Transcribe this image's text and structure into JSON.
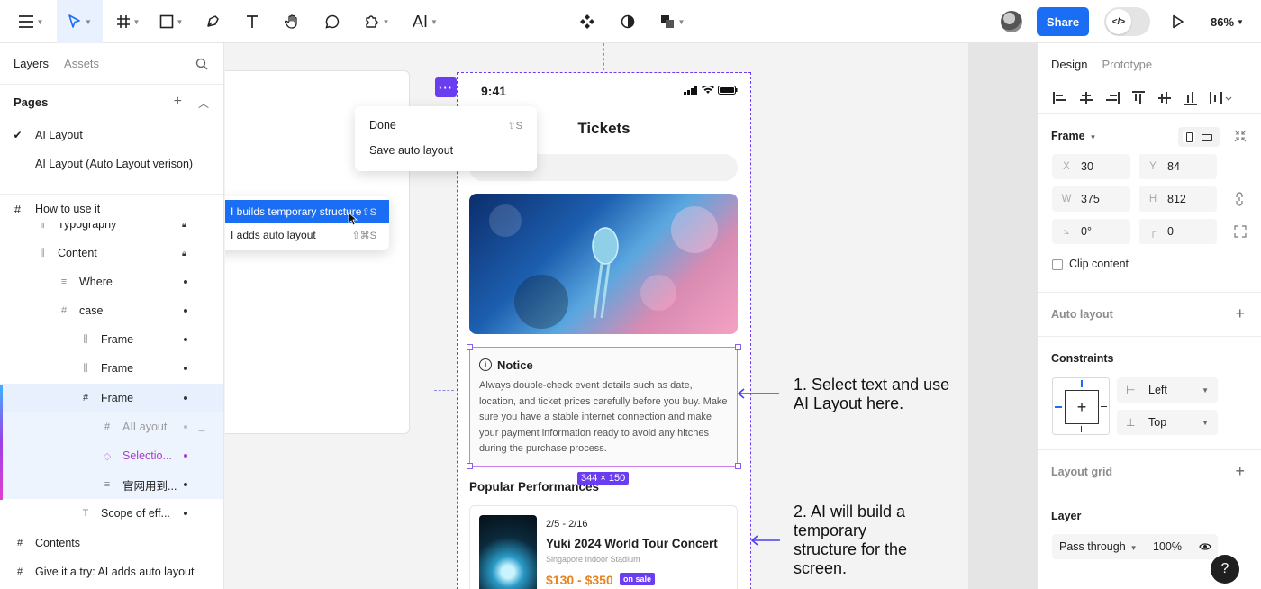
{
  "toolbar": {
    "ai_label": "AI",
    "share": "Share",
    "zoom": "86%"
  },
  "left_panel": {
    "tabs": [
      "Layers",
      "Assets"
    ],
    "pages_heading": "Pages",
    "pages": [
      "AI Layout",
      "AI Layout (Auto Layout verison)"
    ],
    "how_to": "How to use it",
    "layers": [
      {
        "label": "Typography"
      },
      {
        "label": "Content"
      },
      {
        "label": "Where"
      },
      {
        "label": "case"
      },
      {
        "label": "Frame"
      },
      {
        "label": "Frame"
      },
      {
        "label": "Frame"
      },
      {
        "label": "AILayout"
      },
      {
        "label": "Selectio..."
      },
      {
        "label": "官网用到..."
      },
      {
        "label": "Scope of eff..."
      },
      {
        "label": "Contents"
      },
      {
        "label": "Give it a try: AI adds auto layout"
      }
    ]
  },
  "canvas": {
    "menu_top": [
      {
        "label": "Done",
        "shortcut": "⇧S"
      },
      {
        "label": "Save auto layout",
        "shortcut": ""
      }
    ],
    "menu_ai": [
      {
        "label": "I builds temporary structure",
        "shortcut": "⇧S"
      },
      {
        "label": "I adds auto layout",
        "shortcut": "⇧⌘S"
      }
    ],
    "more_button": "···",
    "phone": {
      "time": "9:41",
      "title": "Tickets",
      "notice_title": "Notice",
      "notice_body": "Always double-check event details such as date, location, and ticket prices carefully before you buy. Make sure you have a stable internet connection and make your payment information ready to avoid any hitches during the purchase process.",
      "size_tag": "344 × 150",
      "section_title": "Popular Performances",
      "card": {
        "date": "2/5 - 2/16",
        "name": "Yuki 2024 World Tour Concert",
        "venue": "Singapore Indoor Stadium",
        "price": "$130 - $350",
        "badge": "on sale"
      }
    },
    "annotations": [
      "1. Select text and use AI Layout here.",
      "2.  AI will build a temporary structure for the screen."
    ]
  },
  "right_panel": {
    "tabs": [
      "Design",
      "Prototype"
    ],
    "frame_label": "Frame",
    "fields": {
      "x": {
        "k": "X",
        "v": "30"
      },
      "y": {
        "k": "Y",
        "v": "84"
      },
      "w": {
        "k": "W",
        "v": "375"
      },
      "h": {
        "k": "H",
        "v": "812"
      },
      "rot": {
        "v": "0°"
      },
      "radius": {
        "v": "0"
      }
    },
    "clip_content": "Clip content",
    "auto_layout": "Auto layout",
    "constraints": "Constraints",
    "constraint_h": "Left",
    "constraint_v": "Top",
    "layout_grid": "Layout grid",
    "layer": "Layer",
    "blend": "Pass through",
    "opacity": "100%"
  },
  "help": "?"
}
